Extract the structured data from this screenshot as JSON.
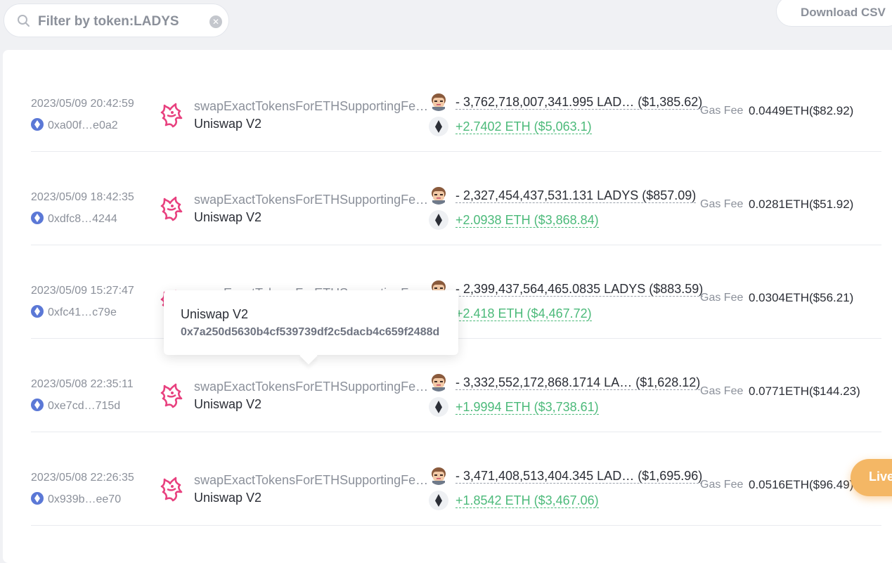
{
  "filter": {
    "text": "Filter by token:LADYS",
    "icon": "search-icon",
    "clear_icon": "close-circle-icon"
  },
  "download_label": "Download CSV",
  "gas_fee_label": "Gas Fee",
  "rows": [
    {
      "date": "2023/05/09 20:42:59",
      "hash": "0xa00f…e0a2",
      "method": "swapExactTokensForETHSupportingFeeO…",
      "platform": "Uniswap V2",
      "out_amount": "- 3,762,718,007,341.995 LAD…  ($1,385.62)",
      "in_amount": "+2.7402 ETH ($5,063.1)",
      "gas_fee": "0.0449ETH($82.92)"
    },
    {
      "date": "2023/05/09 18:42:35",
      "hash": "0xdfc8…4244",
      "method": "swapExactTokensForETHSupportingFeeO…",
      "platform": "Uniswap V2",
      "out_amount": "- 2,327,454,437,531.131 LADYS ($857.09)",
      "in_amount": "+2.0938 ETH ($3,868.84)",
      "gas_fee": "0.0281ETH($51.92)"
    },
    {
      "date": "2023/05/09 15:27:47",
      "hash": "0xfc41…c79e",
      "method": "swapExactTokensForETHSupportingFeeO…",
      "platform": "Uniswap V2",
      "out_amount": "- 2,399,437,564,465.0835 LADYS ($883.59)",
      "in_amount": "+2.418 ETH ($4,467.72)",
      "gas_fee": "0.0304ETH($56.21)"
    },
    {
      "date": "2023/05/08 22:35:11",
      "hash": "0xe7cd…715d",
      "method": "swapExactTokensForETHSupportingFeeO…",
      "platform": "Uniswap V2",
      "out_amount": "- 3,332,552,172,868.1714 LA…  ($1,628.12)",
      "in_amount": "+1.9994 ETH ($3,738.61)",
      "gas_fee": "0.0771ETH($144.23)"
    },
    {
      "date": "2023/05/08 22:26:35",
      "hash": "0x939b…ee70",
      "method": "swapExactTokensForETHSupportingFeeO…",
      "platform": "Uniswap V2",
      "out_amount": "- 3,471,408,513,404.345 LAD…  ($1,695.96)",
      "in_amount": "+1.8542 ETH ($3,467.06)",
      "gas_fee": "0.0516ETH($96.49)"
    }
  ],
  "tooltip": {
    "title": "Uniswap V2",
    "address": "0x7a250d5630b4cf539739df2c5dacb4c659f2488d"
  },
  "live_label": "Live",
  "colors": {
    "positive": "#4cba7a",
    "muted": "#8b909a",
    "live": "#f4b765",
    "uniswap": "#e8417f"
  }
}
